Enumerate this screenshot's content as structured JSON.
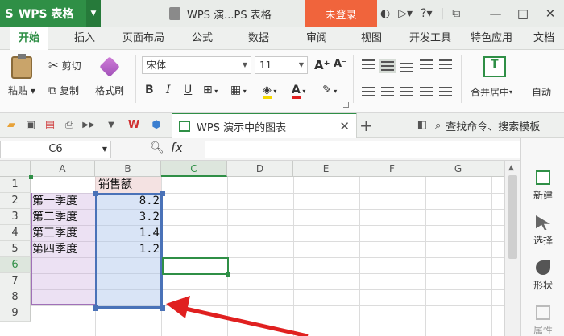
{
  "titlebar": {
    "app_logo": "S",
    "app_name": "WPS 表格",
    "doc_title": "WPS 演...PS 表格",
    "login_label": "未登录",
    "icons": [
      "skin-icon",
      "share-icon",
      "help-icon",
      "minimize-to-tray-icon"
    ],
    "window_buttons": [
      "minimize",
      "maximize",
      "close"
    ]
  },
  "ribbon_tabs": [
    "开始",
    "插入",
    "页面布局",
    "公式",
    "数据",
    "审阅",
    "视图",
    "开发工具",
    "特色应用",
    "文档"
  ],
  "ribbon": {
    "paste_label": "粘贴",
    "cut_label": "剪切",
    "copy_label": "复制",
    "format_painter_label": "格式刷",
    "font_name": "宋体",
    "font_size": "11",
    "bold": "B",
    "italic": "I",
    "underline": "U",
    "font_color_label": "A",
    "increase_font": "A⁺",
    "decrease_font": "A⁻",
    "merge_label": "合并居中",
    "autofit_label": "自动"
  },
  "quickbar": {
    "doc_tab_label": "WPS 演示中的图表",
    "search_label": "查找命令、搜索模板"
  },
  "formula_bar": {
    "cell_ref": "C6",
    "fx_label": "fx",
    "value": ""
  },
  "columns": [
    "A",
    "B",
    "C",
    "D",
    "E",
    "F",
    "G"
  ],
  "rows": [
    "1",
    "2",
    "3",
    "4",
    "5",
    "6",
    "7",
    "8",
    "9"
  ],
  "selected_column": "C",
  "selected_row": "6",
  "cells": {
    "B1": "销售额",
    "A2": "第一季度",
    "B2": "8.2",
    "A3": "第二季度",
    "B3": "3.2",
    "A4": "第三季度",
    "B4": "1.4",
    "A5": "第四季度",
    "B5": "1.2"
  },
  "task_pane": [
    {
      "label": "新建",
      "icon": "new-icon"
    },
    {
      "label": "选择",
      "icon": "select-icon"
    },
    {
      "label": "形状",
      "icon": "shape-icon"
    },
    {
      "label": "属性",
      "icon": "properties-icon"
    }
  ],
  "colors": {
    "brand_green": "#2f8f46",
    "login_orange": "#f0643c",
    "range_blue": "#4a72b8",
    "range_purple": "#a070b8",
    "arrow_red": "#e02020"
  }
}
